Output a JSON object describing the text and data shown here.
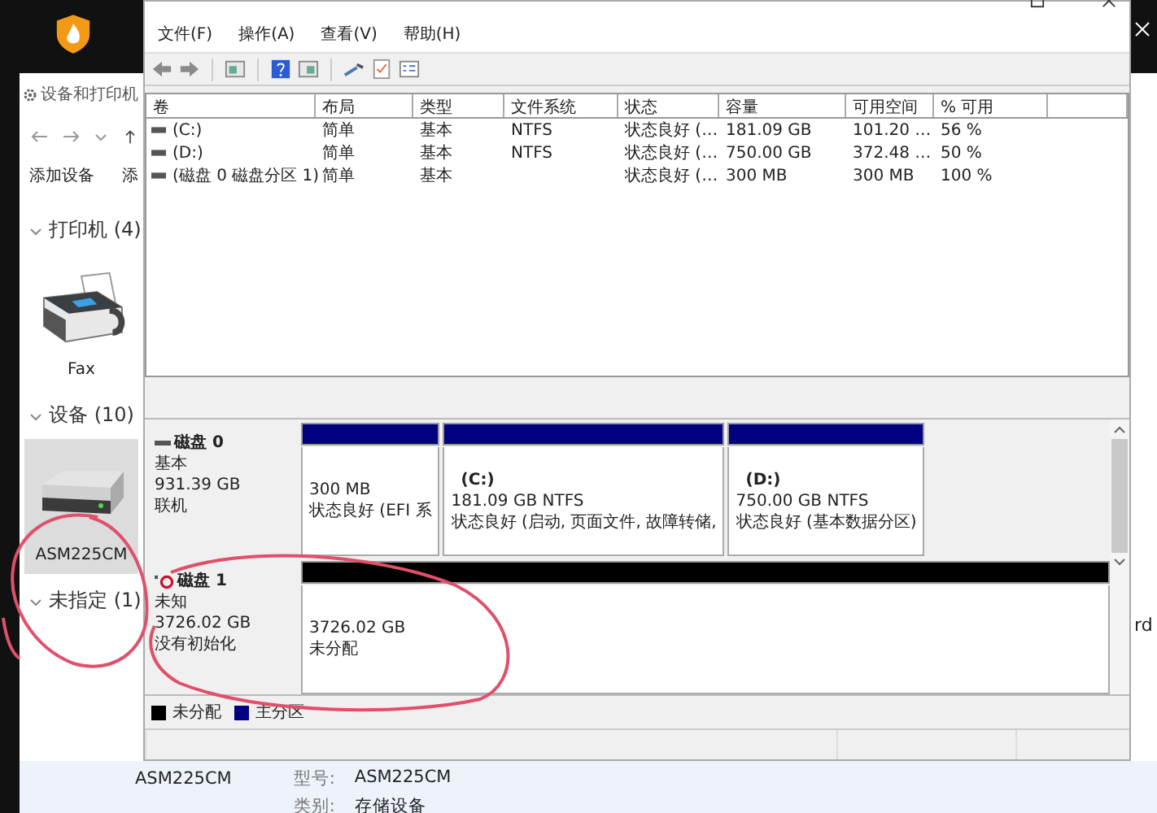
{
  "devices_window": {
    "title": "设备和打印机",
    "toolbar": [
      "添加设备",
      "添"
    ],
    "groups": [
      {
        "label": "打印机 (4)",
        "expanded": true,
        "items": [
          {
            "name": "Fax",
            "kind": "fax",
            "selected": false
          }
        ]
      },
      {
        "label": "设备 (10)",
        "expanded": true,
        "items": [
          {
            "name": "ASM225CM",
            "kind": "drive",
            "selected": true
          }
        ]
      },
      {
        "label": "未指定 (1)",
        "expanded": true
      }
    ],
    "partial_item_label": "rd",
    "details": {
      "name": "ASM225CM",
      "fields": [
        {
          "label": "型号:",
          "value": "ASM225CM"
        },
        {
          "label": "类别:",
          "value": "存储设备"
        }
      ]
    }
  },
  "disk_management": {
    "menu": [
      "文件(F)",
      "操作(A)",
      "查看(V)",
      "帮助(H)"
    ],
    "table": {
      "columns": [
        "卷",
        "布局",
        "类型",
        "文件系统",
        "状态",
        "容量",
        "可用空间",
        "% 可用"
      ],
      "rows": [
        [
          "(C:)",
          "简单",
          "基本",
          "NTFS",
          "状态良好 (…",
          "181.09 GB",
          "101.20 …",
          "56 %"
        ],
        [
          "(D:)",
          "简单",
          "基本",
          "NTFS",
          "状态良好 (…",
          "750.00 GB",
          "372.48 …",
          "50 %"
        ],
        [
          "(磁盘 0 磁盘分区 1)",
          "简单",
          "基本",
          "",
          "状态良好 (…",
          "300 MB",
          "300 MB",
          "100 %"
        ]
      ]
    },
    "disks": [
      {
        "name": "磁盘 0",
        "kind": "online",
        "lines": [
          "基本",
          "931.39 GB",
          "联机"
        ],
        "partitions": [
          {
            "kind": "primary",
            "lines": [
              "300 MB",
              "状态良好 (EFI 系"
            ]
          },
          {
            "kind": "primary",
            "label": "(C:)",
            "lines": [
              "181.09 GB NTFS",
              "状态良好 (启动, 页面文件, 故障转储,"
            ]
          },
          {
            "kind": "primary",
            "label": "(D:)",
            "lines": [
              "750.00 GB NTFS",
              "状态良好 (基本数据分区)"
            ]
          }
        ]
      },
      {
        "name": "磁盘 1",
        "kind": "not_initialized",
        "lines": [
          "未知",
          "3726.02 GB",
          "没有初始化"
        ],
        "partitions": [
          {
            "kind": "unallocated",
            "lines": [
              "3726.02 GB",
              "未分配"
            ]
          }
        ]
      }
    ],
    "legend": [
      {
        "label": "未分配",
        "color": "#000000"
      },
      {
        "label": "主分区",
        "color": "#000080"
      }
    ]
  }
}
